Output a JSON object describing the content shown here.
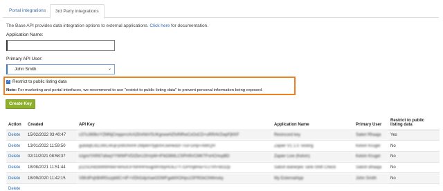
{
  "tabs": [
    {
      "label": "Portal integrations"
    },
    {
      "label": "3rd Party integrations"
    }
  ],
  "intro": {
    "text": "The Base API provides data integration options to external applications.",
    "link": "Click here",
    "suffix": "for documentation."
  },
  "form": {
    "app_name_label": "Application Name:",
    "app_name_value": "",
    "api_user_label": "Primary API User:",
    "api_user_value": "John Smith",
    "restrict_label": "Restrict to public listing data",
    "restrict_checked": true,
    "note_prefix": "Note:",
    "note_text": "For marketing and portal interfaces, we recommend to use \"restrict to public listing data\" to prevent personal information being exposed.",
    "create_button": "Create Key"
  },
  "table": {
    "headers": [
      "Action",
      "Created",
      "API Key",
      "Application Name",
      "Primary User",
      "Restrict to public listing data"
    ],
    "rows": [
      {
        "action": "Delete",
        "created": "15/02/2022 03:40:47",
        "key": "c37xJi69lcrYZMNjCmpprrsXrAZbVAbVSUKgrwwHZfsRiRwCxOoCD+uRRAVZwpFjKKF",
        "app": "Resincord key",
        "user": "Sateri Rhaaja",
        "restrict": "Yes"
      },
      {
        "action": "Delete",
        "created": "13/01/2022 11:59:50",
        "key": "gubdqfLfd2JWLnKqFjnWchnHF2Mp6HYpjbXRJwHedzFTruFGHp+AMrQH",
        "app": "Zapier V1 1.0 Testing",
        "user": "Kelvin Krugel",
        "restrict": "No"
      },
      {
        "action": "Delete",
        "created": "02/11/2021 08:58:37",
        "key": "icIgm/YAR67afwqYYWWFVDIZbrU2hVpM+IFIkD8MLCSPH9VCMKTFsHCHopBD",
        "app": "Zapier Live (Kelvin)",
        "user": "Kelvin Krugel",
        "restrict": "No"
      },
      {
        "action": "Delete",
        "created": "18/08/2021 11:51:44",
        "key": "p1zSOn8zkMWRkkFfeHuIUFNIHHPiisqpWVByHUkJ7Y7DPrnjBHa+VJ7Vh+BGDp",
        "app": "Satish Banerjee Tarik-Shift Check",
        "user": "Satish Bhaaja",
        "restrict": "No"
      },
      {
        "action": "Delete",
        "created": "18/09/2020 11:42:15",
        "key": "V8K4PxjhB4R0uzpb6C+iIF+VDhGdpXaeOOWFgaMXOHps1SFRGkChMmsky",
        "app": "My ExternalApp",
        "user": "John Smith",
        "restrict": "No"
      },
      {
        "action": "Delete",
        "created": "",
        "key": "",
        "app": "",
        "user": "",
        "restrict": ""
      }
    ]
  }
}
